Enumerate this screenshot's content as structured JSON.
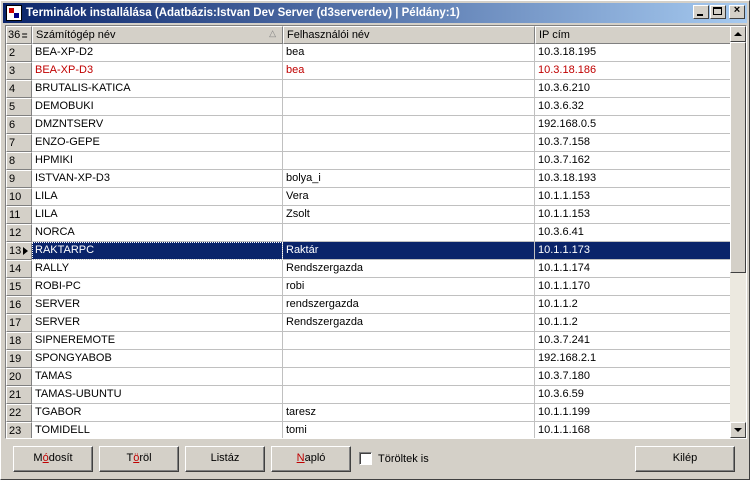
{
  "window": {
    "title": "Terminálok installálása  (Adatbázis:Istvan Dev Server (d3serverdev) | Példány:1)"
  },
  "grid": {
    "record_count": "36",
    "columns": [
      "Számítógép név",
      "Felhasználói név",
      "IP cím"
    ],
    "rows": [
      {
        "num": "2",
        "computer": "BEA-XP-D2",
        "user": "bea",
        "ip": "10.3.18.195"
      },
      {
        "num": "3",
        "computer": "BEA-XP-D3",
        "user": "bea",
        "ip": "10.3.18.186"
      },
      {
        "num": "4",
        "computer": "BRUTALIS-KATICA",
        "user": "",
        "ip": "10.3.6.210"
      },
      {
        "num": "5",
        "computer": "DEMOBUKI",
        "user": "",
        "ip": "10.3.6.32"
      },
      {
        "num": "6",
        "computer": "DMZNTSERV",
        "user": "",
        "ip": "192.168.0.5"
      },
      {
        "num": "7",
        "computer": "ENZO-GEPE",
        "user": "",
        "ip": "10.3.7.158"
      },
      {
        "num": "8",
        "computer": "HPMIKI",
        "user": "",
        "ip": "10.3.7.162"
      },
      {
        "num": "9",
        "computer": "ISTVAN-XP-D3",
        "user": "bolya_i",
        "ip": "10.3.18.193"
      },
      {
        "num": "10",
        "computer": "LILA",
        "user": "Vera",
        "ip": "10.1.1.153"
      },
      {
        "num": "11",
        "computer": "LILA",
        "user": "Zsolt",
        "ip": "10.1.1.153"
      },
      {
        "num": "12",
        "computer": "NORCA",
        "user": "",
        "ip": "10.3.6.41"
      },
      {
        "num": "13",
        "computer": "RAKTARPC",
        "user": "Raktár",
        "ip": "10.1.1.173"
      },
      {
        "num": "14",
        "computer": "RALLY",
        "user": "Rendszergazda",
        "ip": "10.1.1.174"
      },
      {
        "num": "15",
        "computer": "ROBI-PC",
        "user": "robi",
        "ip": "10.1.1.170"
      },
      {
        "num": "16",
        "computer": "SERVER",
        "user": "rendszergazda",
        "ip": "10.1.1.2"
      },
      {
        "num": "17",
        "computer": "SERVER",
        "user": "Rendszergazda",
        "ip": "10.1.1.2"
      },
      {
        "num": "18",
        "computer": "SIPNEREMOTE",
        "user": "",
        "ip": "10.3.7.241"
      },
      {
        "num": "19",
        "computer": "SPONGYABOB",
        "user": "",
        "ip": "192.168.2.1"
      },
      {
        "num": "20",
        "computer": "TAMAS",
        "user": "",
        "ip": "10.3.7.180"
      },
      {
        "num": "21",
        "computer": "TAMAS-UBUNTU",
        "user": "",
        "ip": "10.3.6.59"
      },
      {
        "num": "22",
        "computer": "TGABOR",
        "user": "taresz",
        "ip": "10.1.1.199"
      },
      {
        "num": "23",
        "computer": "TOMIDELL",
        "user": "tomi",
        "ip": "10.1.1.168"
      }
    ],
    "selected_row": "13",
    "highlighted_row": "3"
  },
  "buttons": {
    "modify": {
      "pre": "M",
      "hk": "ó",
      "post": "dosít"
    },
    "delete": {
      "pre": "T",
      "hk": "ö",
      "post": "röl"
    },
    "list": {
      "pre": "Listáz",
      "hk": "",
      "post": ""
    },
    "log": {
      "pre": "",
      "hk": "N",
      "post": "apló"
    },
    "exit": {
      "pre": "Kilép",
      "hk": "",
      "post": ""
    }
  },
  "checkbox": {
    "label": "Töröltek is",
    "checked": false
  },
  "colors": {
    "selection": "#0a246a",
    "highlight_text": "#c00000",
    "title_gradient_start": "#0a246a"
  }
}
